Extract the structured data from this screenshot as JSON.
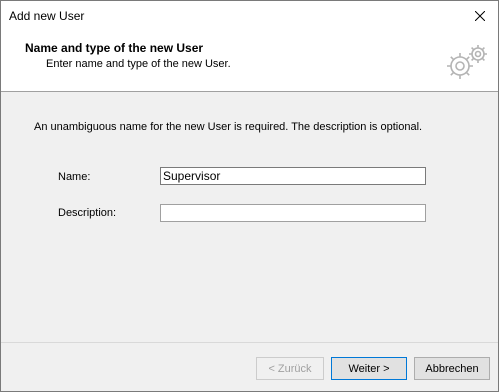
{
  "window": {
    "title": "Add new User"
  },
  "header": {
    "title": "Name and type of the new User",
    "subtitle": "Enter name and type of the new User.",
    "icon": "gear-icon"
  },
  "body": {
    "intro": "An unambiguous name for the new User is required. The description is optional.",
    "name_label": "Name:",
    "name_value": "Supervisor",
    "description_label": "Description:",
    "description_value": ""
  },
  "buttons": {
    "back": "< Zurück",
    "next": "Weiter >",
    "cancel": "Abbrechen"
  }
}
